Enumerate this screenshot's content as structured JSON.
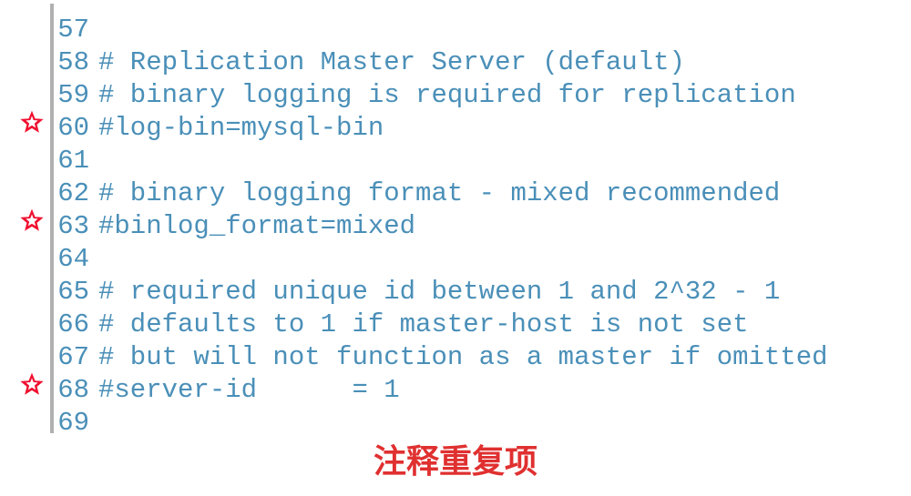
{
  "lines": [
    {
      "num": "57",
      "text": "",
      "star": false
    },
    {
      "num": "58",
      "text": "# Replication Master Server (default)",
      "star": false
    },
    {
      "num": "59",
      "text": "# binary logging is required for replication",
      "star": false
    },
    {
      "num": "60",
      "text": "#log-bin=mysql-bin",
      "star": true
    },
    {
      "num": "61",
      "text": "",
      "star": false
    },
    {
      "num": "62",
      "text": "# binary logging format - mixed recommended",
      "star": false
    },
    {
      "num": "63",
      "text": "#binlog_format=mixed",
      "star": true
    },
    {
      "num": "64",
      "text": "",
      "star": false
    },
    {
      "num": "65",
      "text": "# required unique id between 1 and 2^32 - 1",
      "star": false
    },
    {
      "num": "66",
      "text": "# defaults to 1 if master-host is not set",
      "star": false
    },
    {
      "num": "67",
      "text": "# but will not function as a master if omitted",
      "star": false
    },
    {
      "num": "68",
      "text": "#server-id      = 1",
      "star": true
    },
    {
      "num": "69",
      "text": "",
      "star": false
    }
  ],
  "caption": "注释重复项",
  "star_color": "#f01030"
}
